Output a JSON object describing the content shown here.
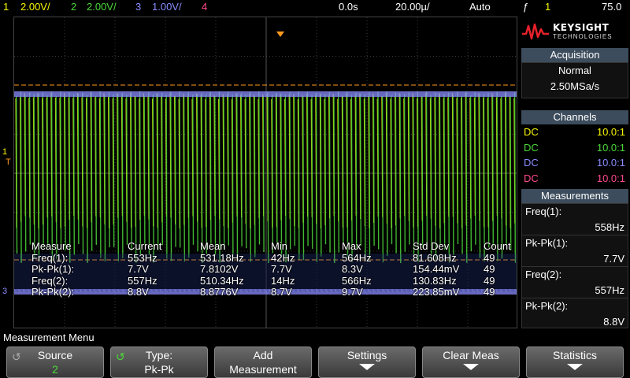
{
  "topbar": {
    "ch1_num": "1",
    "ch1_scale": "2.00V/",
    "ch2_num": "2",
    "ch2_scale": "2.00V/",
    "ch3_num": "3",
    "ch3_scale": "1.00V/",
    "ch4_num": "4",
    "time_offset": "0.0s",
    "time_scale": "20.00µ/",
    "trigger_mode": "Auto",
    "trigger_slope": "ƒ",
    "trigger_source": "1",
    "trigger_level": "75.0"
  },
  "markers": {
    "ch1": "1",
    "trigger": "T",
    "ch3": "3"
  },
  "meas_table": {
    "headers": [
      "Measure",
      "Current",
      "Mean",
      "Min",
      "Max",
      "Std Dev",
      "Count"
    ],
    "rows": [
      [
        "Freq(1):",
        "553Hz",
        "531.18Hz",
        "42Hz",
        "564Hz",
        "81.608Hz",
        "49"
      ],
      [
        "Pk-Pk(1):",
        "7.7V",
        "7.8102V",
        "7.7V",
        "8.3V",
        "154.44mV",
        "49"
      ],
      [
        "Freq(2):",
        "557Hz",
        "510.34Hz",
        "14Hz",
        "566Hz",
        "130.83Hz",
        "49"
      ],
      [
        "Pk-Pk(2):",
        "8.8V",
        "8.8776V",
        "8.7V",
        "9.7V",
        "223.85mV",
        "49"
      ]
    ]
  },
  "logo": {
    "brand": "KEYSIGHT",
    "sub": "TECHNOLOGIES"
  },
  "acquisition": {
    "title": "Acquisition",
    "mode": "Normal",
    "rate": "2.50MSa/s"
  },
  "channels": {
    "title": "Channels",
    "rows": [
      {
        "coupling": "DC",
        "probe": "10.0:1",
        "color": "#f7f700"
      },
      {
        "coupling": "DC",
        "probe": "10.0:1",
        "color": "#4cd93a"
      },
      {
        "coupling": "DC",
        "probe": "10.0:1",
        "color": "#8a8cff"
      },
      {
        "coupling": "DC",
        "probe": "10.0:1",
        "color": "#ff4a8c"
      }
    ]
  },
  "measurements": {
    "title": "Measurements",
    "items": [
      {
        "label": "Freq(1):",
        "value": "558Hz"
      },
      {
        "label": "Pk-Pk(1):",
        "value": "7.7V"
      },
      {
        "label": "Freq(2):",
        "value": "557Hz"
      },
      {
        "label": "Pk-Pk(2):",
        "value": "8.8V"
      }
    ]
  },
  "menu": {
    "title": "Measurement Menu",
    "keys": [
      {
        "line1": "Source",
        "line2": "2"
      },
      {
        "line1": "Type:",
        "line2": "Pk-Pk"
      },
      {
        "line1": "Add",
        "line2": "Measurement"
      },
      {
        "line1": "Settings",
        "line2": ""
      },
      {
        "line1": "Clear Meas",
        "line2": ""
      },
      {
        "line1": "Statistics",
        "line2": ""
      }
    ]
  },
  "colors": {
    "ch1": "#f7f700",
    "ch2": "#4cd93a",
    "ch3": "#8a8cff",
    "ch4": "#ff4a8c",
    "grid": "#3a3a3a",
    "trigger_line": "#ff9a20",
    "panel_header": "#3c4c5c"
  }
}
